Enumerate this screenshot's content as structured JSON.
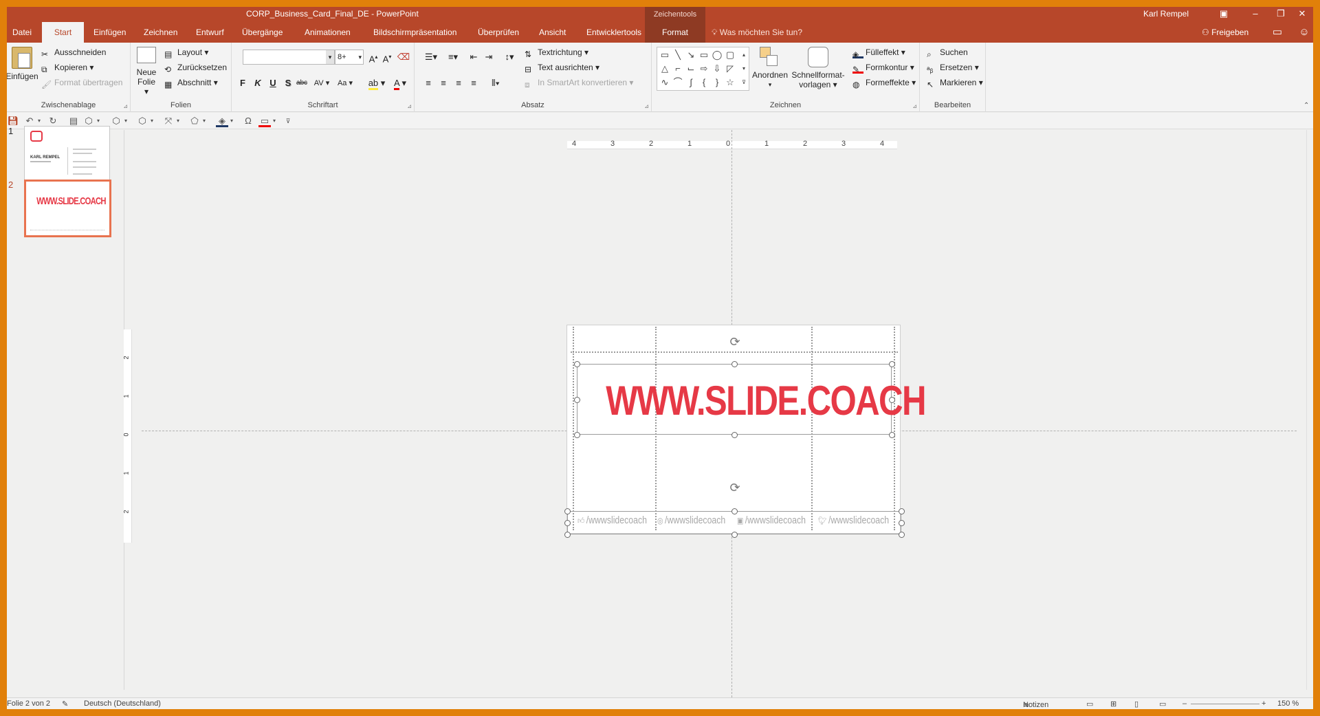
{
  "titlebar": {
    "document": "CORP_Business_Card_Final_DE  -  PowerPoint",
    "context_group": "Zeichentools",
    "user": "Karl Rempel",
    "ribbon_display_icon": "ribbon-display-options-icon",
    "minimize_icon": "minimize-icon",
    "maximize_icon": "restore-icon",
    "close_icon": "close-icon"
  },
  "tabs": [
    "Datei",
    "Start",
    "Einfügen",
    "Zeichnen",
    "Entwurf",
    "Übergänge",
    "Animationen",
    "Bildschirmpräsentation",
    "Überprüfen",
    "Ansicht",
    "Entwicklertools",
    "Format"
  ],
  "active_tab": "Start",
  "tellme": "Was möchten Sie tun?",
  "share": "Freigeben",
  "ribbon": {
    "clipboard": {
      "label": "Zwischenablage",
      "paste": "Einfügen",
      "cut": "Ausschneiden",
      "copy": "Kopieren",
      "format_painter": "Format übertragen"
    },
    "slides": {
      "label": "Folien",
      "new_slide_1": "Neue",
      "new_slide_2": "Folie",
      "layout": "Layout",
      "reset": "Zurücksetzen",
      "section": "Abschnitt"
    },
    "font": {
      "label": "Schriftart",
      "font_name": "",
      "font_size": "8+",
      "bold": "F",
      "italic": "K",
      "underline": "U",
      "shadow": "S",
      "strike": "abc",
      "spacing": "AV",
      "case": "Aa"
    },
    "paragraph": {
      "label": "Absatz",
      "text_direction": "Textrichtung",
      "align_text": "Text ausrichten",
      "smartart": "In SmartArt konvertieren"
    },
    "drawing": {
      "label": "Zeichnen",
      "arrange": "Anordnen",
      "quick_styles_1": "Schnellformat-",
      "quick_styles_2": "vorlagen",
      "fill": "Fülleffekt",
      "outline": "Formkontur",
      "effects": "Formeffekte"
    },
    "editing": {
      "label": "Bearbeiten",
      "find": "Suchen",
      "replace": "Ersetzen",
      "select": "Markieren"
    }
  },
  "thumbnails": {
    "slide1_num": "1",
    "slide2_num": "2",
    "slide1_name": "KARL REMPEL",
    "slide2_text": "WWW.SLIDE.COACH"
  },
  "ruler": {
    "h_ticks": [
      "4",
      "3",
      "2",
      "1",
      "0",
      "1",
      "2",
      "3",
      "4"
    ],
    "v_ticks": [
      "2",
      "1",
      "0",
      "1",
      "2"
    ]
  },
  "slide": {
    "url": "WWW.SLIDE.COACH",
    "accent": "#e63946",
    "social": [
      {
        "icon": "thumbs-up-icon",
        "text": "/wwwslidecoach"
      },
      {
        "icon": "instagram-icon",
        "text": "/wwwslidecoach"
      },
      {
        "icon": "youtube-icon",
        "text": "/wwwslidecoach"
      },
      {
        "icon": "twitter-icon",
        "text": "/wwwslidecoach"
      }
    ]
  },
  "status": {
    "slide_of": "Folie 2 von 2",
    "language": "Deutsch (Deutschland)",
    "notes": "Notizen",
    "zoom": "150 %"
  },
  "colors": {
    "ppt_red": "#b7472a",
    "context_red": "#8e3a23",
    "thumb_selected": "#e8734f",
    "outer_frame": "#e1800a"
  }
}
